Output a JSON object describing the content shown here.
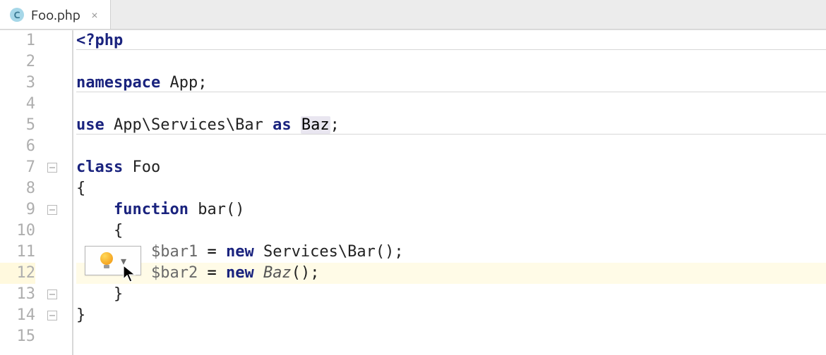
{
  "tab": {
    "filename": "Foo.php",
    "icon_letter": "C",
    "close_glyph": "×"
  },
  "gutter": {
    "start": 1,
    "end": 15,
    "highlighted_line": 12
  },
  "code": {
    "l1": {
      "php_open": "<?php"
    },
    "l2": "",
    "l3": {
      "kw": "namespace",
      "ns": "App",
      "semi": ";"
    },
    "l4": "",
    "l5": {
      "kw1": "use",
      "ns": "App\\Services\\Bar",
      "kw2": "as",
      "alias": "Baz",
      "semi": ";"
    },
    "l6": "",
    "l7": {
      "kw": "class",
      "name": "Foo"
    },
    "l8": {
      "brace": "{"
    },
    "l9": {
      "indent": "    ",
      "kw": "function",
      "name": "bar",
      "paren": "()"
    },
    "l10": {
      "indent": "    ",
      "brace": "{"
    },
    "l11": {
      "indent": "        ",
      "var": "$bar1",
      "eq": " = ",
      "kw": "new",
      "sp": " ",
      "nsref": "Services\\Bar",
      "call": "()",
      "semi": ";"
    },
    "l12": {
      "indent": "        ",
      "var": "$bar2",
      "eq": " = ",
      "kw": "new",
      "sp": " ",
      "clsref": "Baz",
      "call": "()",
      "semi": ";"
    },
    "l13": {
      "indent": "    ",
      "brace": "}"
    },
    "l14": {
      "brace": "}"
    },
    "l15": ""
  },
  "intention": {
    "bulb_icon": "lightbulb-icon",
    "dropdown_glyph": "▾"
  },
  "colors": {
    "keyword": "#1a237e",
    "muted_var": "#6a6a6a",
    "highlight_bg": "#fffbe7",
    "alias_hl": "#e9e6f0"
  }
}
